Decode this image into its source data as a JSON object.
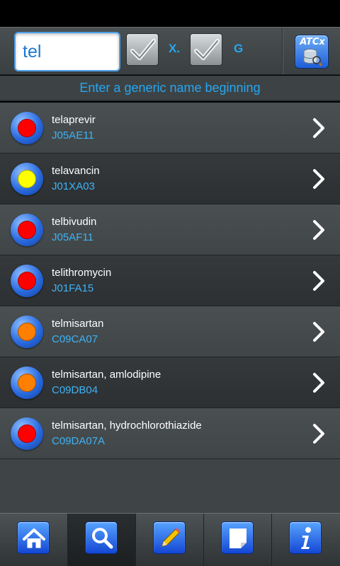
{
  "search": {
    "value": "tel"
  },
  "options": {
    "x_label": "X.",
    "g_label": "G"
  },
  "atc_button": {
    "label": "ATCx"
  },
  "hint": "Enter a generic name beginning",
  "results": [
    {
      "name": "telaprevir",
      "code": "J05AE11",
      "dot_color": "#ff0000"
    },
    {
      "name": "telavancin",
      "code": "J01XA03",
      "dot_color": "#ffff00"
    },
    {
      "name": "telbivudin",
      "code": "J05AF11",
      "dot_color": "#ff0000"
    },
    {
      "name": "telithromycin",
      "code": "J01FA15",
      "dot_color": "#ff0000"
    },
    {
      "name": "telmisartan",
      "code": "C09CA07",
      "dot_color": "#ff7f00"
    },
    {
      "name": "telmisartan, amlodipine",
      "code": "C09DB04",
      "dot_color": "#ff7f00"
    },
    {
      "name": "telmisartan, hydrochlorothiazide",
      "code": "C09DA07A",
      "dot_color": "#ff0000"
    }
  ],
  "tabs": [
    {
      "icon": "home-icon"
    },
    {
      "icon": "search-icon",
      "active": true
    },
    {
      "icon": "pencil-icon"
    },
    {
      "icon": "note-icon"
    },
    {
      "icon": "info-icon"
    }
  ]
}
